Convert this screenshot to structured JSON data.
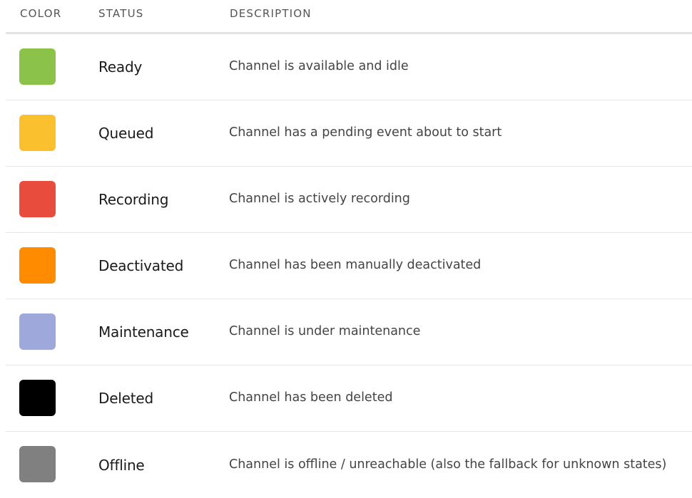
{
  "headers": {
    "color": "COLOR",
    "status": "STATUS",
    "description": "DESCRIPTION"
  },
  "rows": [
    {
      "color": "#8bc34a",
      "status": "Ready",
      "description": "Channel is available and idle"
    },
    {
      "color": "#fbc02d",
      "status": "Queued",
      "description": "Channel has a pending event about to start"
    },
    {
      "color": "#e74c3c",
      "status": "Recording",
      "description": "Channel is actively recording"
    },
    {
      "color": "#ff8c00",
      "status": "Deactivated",
      "description": "Channel has been manually deactivated"
    },
    {
      "color": "#9fa8da",
      "status": "Maintenance",
      "description": "Channel is under maintenance"
    },
    {
      "color": "#000000",
      "status": "Deleted",
      "description": "Channel has been deleted"
    },
    {
      "color": "#808080",
      "status": "Offline",
      "description": "Channel is offline / unreachable (also the fallback for unknown states)"
    }
  ]
}
